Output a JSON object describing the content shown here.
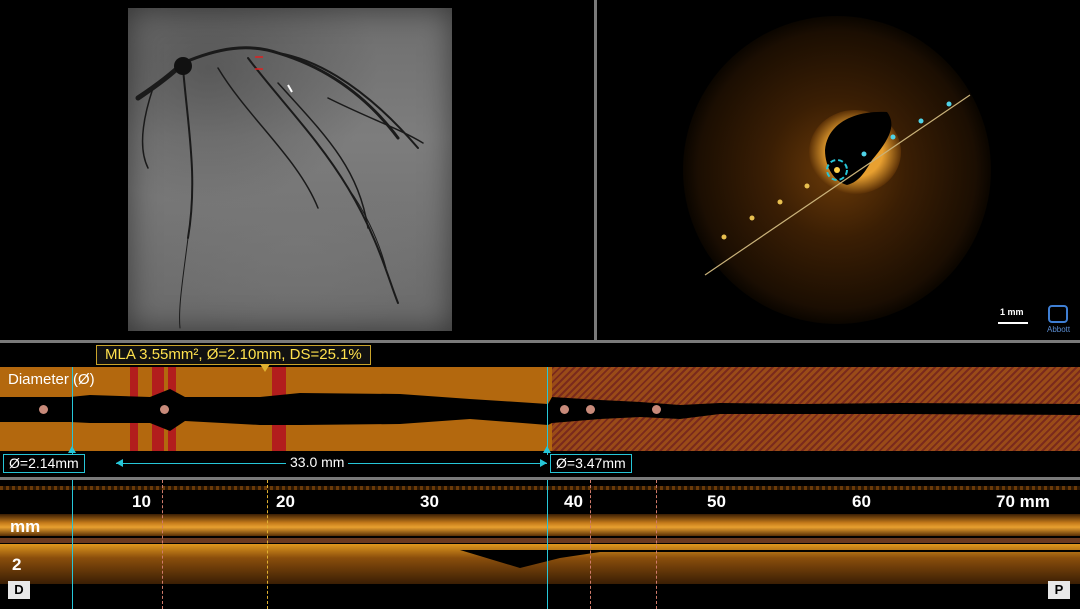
{
  "oct": {
    "scale_label": "1 mm",
    "brand": "Abbott"
  },
  "diameter": {
    "mla_summary": "MLA 3.55mm², Ø=2.10mm, DS=25.1%",
    "track_title": "Diameter (Ø)",
    "distal_ref": "Ø=2.14mm",
    "length": "33.0 mm",
    "proximal_ref": "Ø=3.47mm"
  },
  "longitudinal": {
    "ticks": [
      "10",
      "20",
      "30",
      "40",
      "50",
      "60",
      "70 mm"
    ],
    "unit_label": "mm",
    "depth_label": "2",
    "distal_button": "D",
    "proximal_button": "P"
  },
  "colors": {
    "accent_cyan": "#26c6d8",
    "mla_yellow": "#ffe14d",
    "track_orange": "#b3680e",
    "band_red": "#b21d1d"
  }
}
